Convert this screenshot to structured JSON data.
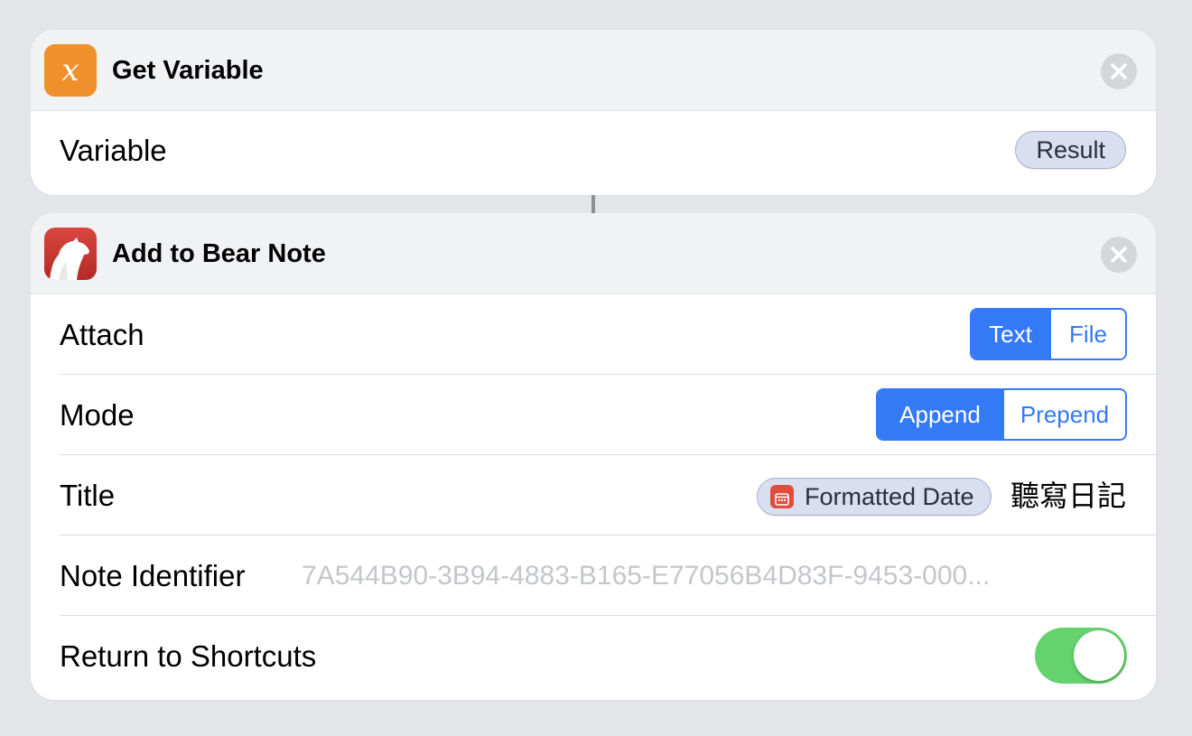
{
  "get_variable": {
    "title": "Get Variable",
    "icon": "variable-x-icon",
    "icon_glyph": "x",
    "variable_label": "Variable",
    "variable_value": "Result"
  },
  "bear_note": {
    "title": "Add to Bear Note",
    "icon": "bear-app-icon",
    "attach": {
      "label": "Attach",
      "options": [
        "Text",
        "File"
      ],
      "selected": "Text"
    },
    "mode": {
      "label": "Mode",
      "options": [
        "Append",
        "Prepend"
      ],
      "selected": "Append"
    },
    "title_row": {
      "label": "Title",
      "token": "Formatted Date",
      "suffix": "聽寫日記"
    },
    "note_identifier": {
      "label": "Note Identifier",
      "placeholder": "7A544B90-3B94-4883-B165-E77056B4D83F-9453-000..."
    },
    "return_to_shortcuts": {
      "label": "Return to Shortcuts",
      "enabled": true
    }
  },
  "colors": {
    "accent": "#3479f6",
    "toggle_on": "#65d26e",
    "variable_icon": "#f08c2b",
    "bear_icon": "#c9302c"
  }
}
